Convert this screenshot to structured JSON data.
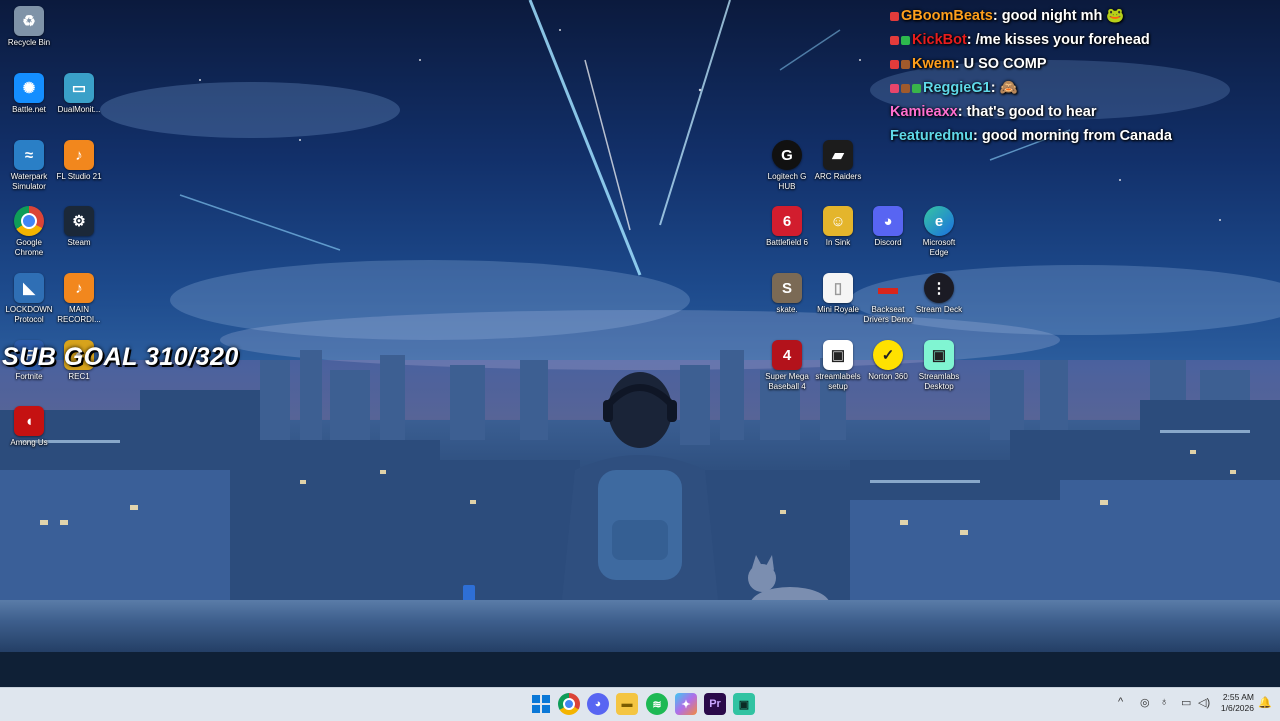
{
  "desktop": {
    "icons": [
      {
        "label": "Recycle Bin",
        "icon": "recycle-bin-icon",
        "color": "#7f93a8",
        "glyph": "♻"
      },
      {
        "label": "Battle.net",
        "icon": "battlenet-icon",
        "color": "#148eff",
        "glyph": "✺"
      },
      {
        "label": "DualMonit...",
        "icon": "dualmonitor-icon",
        "color": "#3aa0c8",
        "glyph": "▭"
      },
      {
        "label": "Waterpark Simulator",
        "icon": "waterpark-icon",
        "color": "#2a7fc6",
        "glyph": "≈"
      },
      {
        "label": "FL Studio 21",
        "icon": "flstudio-icon",
        "color": "#f2871d",
        "glyph": "♪"
      },
      {
        "label": "Google Chrome",
        "icon": "chrome-icon",
        "color": "#ffffff",
        "glyph": "◉"
      },
      {
        "label": "Steam",
        "icon": "steam-icon",
        "color": "#1b2838",
        "glyph": "⚙"
      },
      {
        "label": "LOCKDOWN Protocol",
        "icon": "lockdown-icon",
        "color": "#2f6fb5",
        "glyph": "◣"
      },
      {
        "label": "MAIN RECORDI...",
        "icon": "flstudio-icon",
        "color": "#f2871d",
        "glyph": "♪"
      },
      {
        "label": "Fortnite",
        "icon": "fortnite-icon",
        "color": "#2b5aa8",
        "glyph": "F"
      },
      {
        "label": "REC1",
        "icon": "rec-icon",
        "color": "#d7a31c",
        "glyph": "●"
      },
      {
        "label": "Among Us",
        "icon": "amongus-icon",
        "color": "#c51111",
        "glyph": "◖"
      },
      {
        "label": "Logitech G HUB",
        "icon": "logitech-icon",
        "color": "#111111",
        "glyph": "G"
      },
      {
        "label": "ARC Raiders",
        "icon": "arcraiders-icon",
        "color": "#1c1c1c",
        "glyph": "▰"
      },
      {
        "label": "Battlefield 6",
        "icon": "battlefield-icon",
        "color": "#d21d2e",
        "glyph": "6"
      },
      {
        "label": "In Sink",
        "icon": "insink-icon",
        "color": "#e4b52c",
        "glyph": "☺"
      },
      {
        "label": "Discord",
        "icon": "discord-icon",
        "color": "#5865f2",
        "glyph": "◕"
      },
      {
        "label": "Microsoft Edge",
        "icon": "edge-icon",
        "color": "#1b9de2",
        "glyph": "e"
      },
      {
        "label": "skate.",
        "icon": "skate-icon",
        "color": "#7b6a55",
        "glyph": "S"
      },
      {
        "label": "Mini Royale",
        "icon": "file-icon",
        "color": "#f5f5f5",
        "glyph": "▯"
      },
      {
        "label": "Backseat Drivers Demo",
        "icon": "car-icon",
        "color": "#c0231b",
        "glyph": "▬"
      },
      {
        "label": "Stream Deck",
        "icon": "streamdeck-icon",
        "color": "#1b1b24",
        "glyph": "⋮"
      },
      {
        "label": "Super Mega Baseball 4",
        "icon": "smb4-icon",
        "color": "#b3121b",
        "glyph": "4"
      },
      {
        "label": "streamlabels setup",
        "icon": "streamlabs-icon",
        "color": "#ffffff",
        "glyph": "▣"
      },
      {
        "label": "Norton 360",
        "icon": "norton-icon",
        "color": "#ffe100",
        "glyph": "✓"
      },
      {
        "label": "Streamlabs Desktop",
        "icon": "streamlabs-icon",
        "color": "#80f5d2",
        "glyph": "▣"
      }
    ]
  },
  "chat": {
    "messages": [
      {
        "user": "GBoomBeats",
        "user_color": "#ff9f1c",
        "text": "good night mh 🐸"
      },
      {
        "user": "KickBot",
        "user_color": "#e81d1d",
        "text": "/me kisses your forehead"
      },
      {
        "user": "Kwem",
        "user_color": "#ff9f1c",
        "text": "U SO COMP"
      },
      {
        "user": "ReggieG1",
        "user_color": "#5fd8e8",
        "text": "🙈"
      },
      {
        "user": "Kamieaxx",
        "user_color": "#ff6fd0",
        "text": "that's good to hear"
      },
      {
        "user": "Featuredmu",
        "user_color": "#5fd8e8",
        "text": "good morning from Canada"
      }
    ]
  },
  "overlay": {
    "sub_goal": "SUB GOAL 310/320"
  },
  "taskbar": {
    "apps": [
      {
        "name": "start-button",
        "color": "#0a78d7",
        "glyph": "⊞"
      },
      {
        "name": "chrome-taskbar",
        "color": "#ffffff",
        "glyph": "◉"
      },
      {
        "name": "discord-taskbar",
        "color": "#5865f2",
        "glyph": "◕"
      },
      {
        "name": "file-explorer-taskbar",
        "color": "#f4c542",
        "glyph": "▬"
      },
      {
        "name": "spotify-taskbar",
        "color": "#1db954",
        "glyph": "≋"
      },
      {
        "name": "copilot-taskbar",
        "color": "#b06ee8",
        "glyph": "✦"
      },
      {
        "name": "premiere-taskbar",
        "color": "#2a0a4a",
        "glyph": "Pr"
      },
      {
        "name": "streamlabs-taskbar",
        "color": "#31c3a2",
        "glyph": "▣"
      }
    ],
    "time": "2:55 AM",
    "date": "1/6/2026"
  }
}
